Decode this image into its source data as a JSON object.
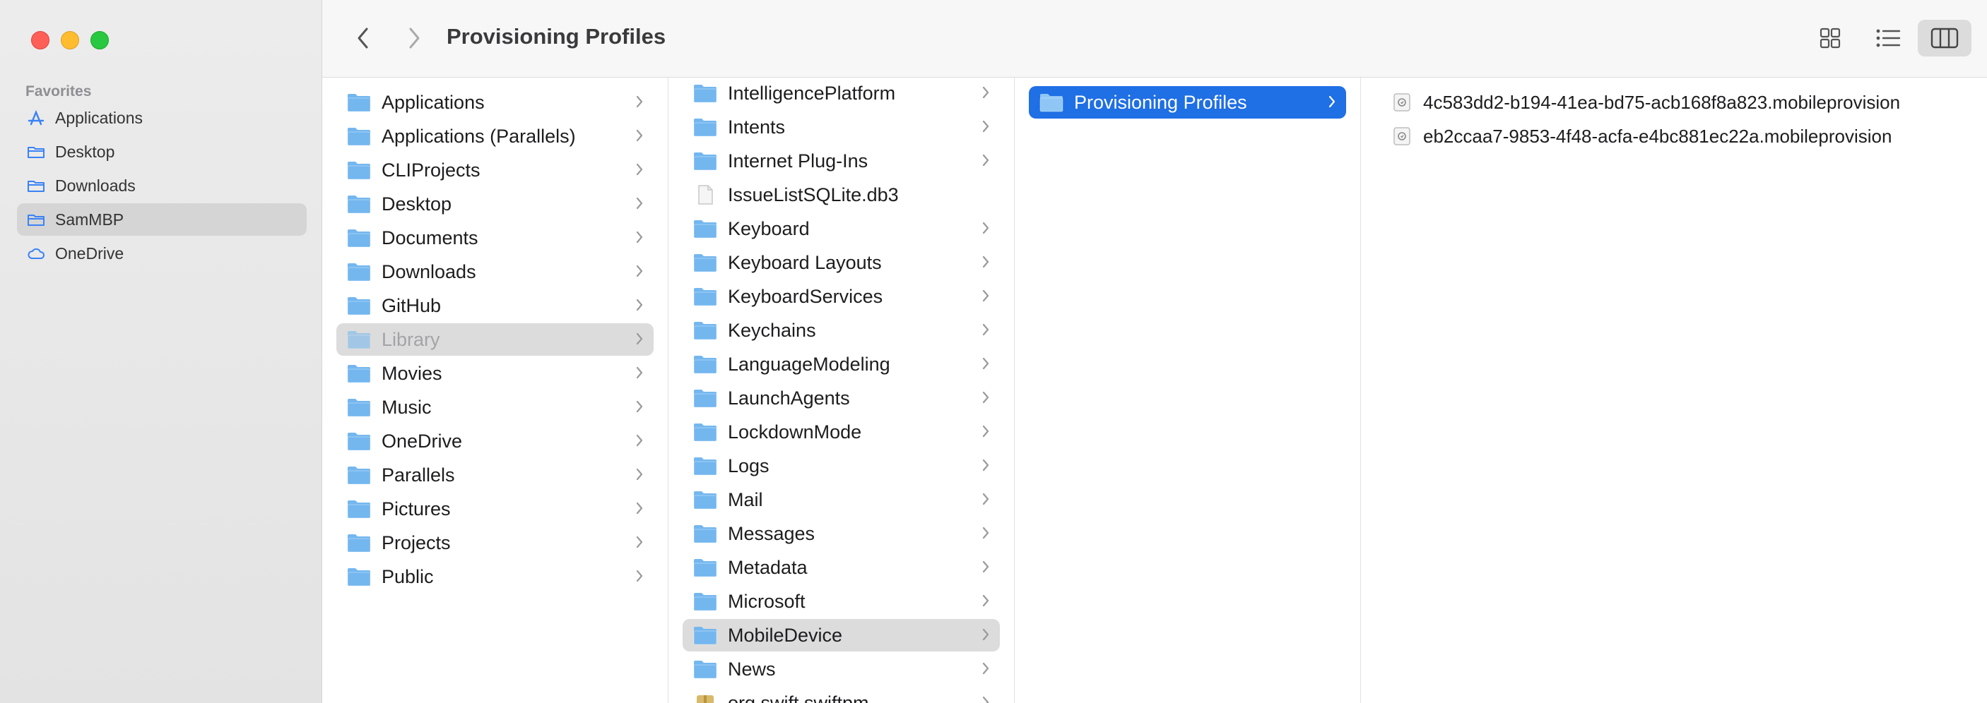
{
  "sidebar": {
    "section_title": "Favorites",
    "items": [
      {
        "label": "Applications",
        "icon": "applications-icon"
      },
      {
        "label": "Desktop",
        "icon": "folder-icon"
      },
      {
        "label": "Downloads",
        "icon": "folder-icon"
      },
      {
        "label": "SamMBP",
        "icon": "folder-icon",
        "selected": true
      },
      {
        "label": "OneDrive",
        "icon": "cloud-icon"
      }
    ]
  },
  "toolbar": {
    "title": "Provisioning Profiles",
    "back_icon": "chevron-left-icon",
    "forward_icon": "chevron-right-icon",
    "view_modes": [
      "icon-view-icon",
      "list-view-icon",
      "column-view-icon"
    ],
    "active_view": "column-view-icon"
  },
  "columns": {
    "home": [
      "Applications",
      "Applications (Parallels)",
      "CLIProjects",
      "Desktop",
      "Documents",
      "Downloads",
      "GitHub",
      "Library",
      "Movies",
      "Music",
      "OneDrive",
      "Parallels",
      "Pictures",
      "Projects",
      "Public"
    ],
    "home_selected": "Library",
    "library": [
      "IntelligencePlatform",
      "Intents",
      "Internet Plug-Ins",
      "IssueListSQLite.db3",
      "Keyboard",
      "Keyboard Layouts",
      "KeyboardServices",
      "Keychains",
      "LanguageModeling",
      "LaunchAgents",
      "LockdownMode",
      "Logs",
      "Mail",
      "Messages",
      "Metadata",
      "Microsoft",
      "MobileDevice",
      "News",
      "org.swift.swiftpm"
    ],
    "library_selected": "MobileDevice",
    "mobiledevice": [
      "Provisioning Profiles"
    ],
    "profiles": [
      "4c583dd2-b194-41ea-bd75-acb168f8a823.mobileprovision",
      "eb2ccaa7-9853-4f48-acfa-e4bc881ec22a.mobileprovision"
    ]
  },
  "colors": {
    "accent": "#1f6fe5",
    "folder": "#74b7ef",
    "sidebar_icon": "#3b82f6"
  }
}
